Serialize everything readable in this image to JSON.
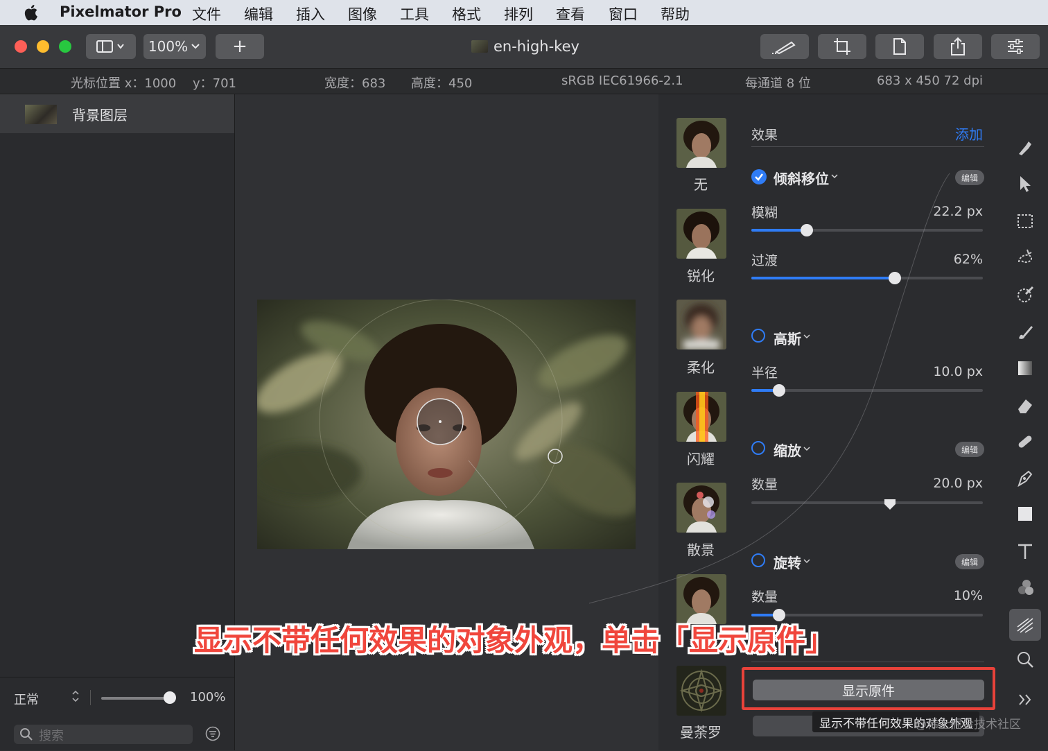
{
  "menubar": {
    "app_name": "Pixelmator Pro",
    "items": [
      "文件",
      "编辑",
      "插入",
      "图像",
      "工具",
      "格式",
      "排列",
      "查看",
      "窗口",
      "帮助"
    ]
  },
  "toolbar": {
    "zoom": "100%",
    "add_label": "+",
    "document_title": "en-high-key"
  },
  "infobar": {
    "cursor_x": "光标位置 x：1000",
    "cursor_y": "y：701",
    "width": "宽度：683",
    "height": "高度：450",
    "color_profile": "sRGB IEC61966-2.1",
    "bit_depth": "每通道 8 位",
    "dimensions": "683 x 450 72 dpi"
  },
  "layers": {
    "items": [
      {
        "name": "背景图层"
      }
    ],
    "blend_mode": "正常",
    "opacity": "100%",
    "search_placeholder": "搜索"
  },
  "effects_browser": {
    "items": [
      {
        "label": "无"
      },
      {
        "label": "锐化"
      },
      {
        "label": "柔化"
      },
      {
        "label": "闪耀"
      },
      {
        "label": "散景"
      },
      {
        "label": ""
      },
      {
        "label": "曼荼罗"
      }
    ]
  },
  "effects_panel": {
    "header": "效果",
    "add_label": "添加",
    "edit_label": "编辑",
    "effects": [
      {
        "name": "倾斜移位",
        "enabled": true,
        "params": [
          {
            "label": "模糊",
            "value": "22.2 px",
            "fraction": 0.24
          },
          {
            "label": "过渡",
            "value": "62%",
            "fraction": 0.62
          }
        ]
      },
      {
        "name": "高斯",
        "enabled": false,
        "params": [
          {
            "label": "半径",
            "value": "10.0 px",
            "fraction": 0.12
          }
        ]
      },
      {
        "name": "缩放",
        "enabled": false,
        "params": [
          {
            "label": "数量",
            "value": "20.0 px",
            "fraction": 0.6
          }
        ]
      },
      {
        "name": "旋转",
        "enabled": false,
        "params": [
          {
            "label": "数量",
            "value": "10%",
            "fraction": 0.12
          }
        ]
      }
    ],
    "show_original_label": "显示原件",
    "tooltip": "显示不带任何效果的对象外观"
  },
  "caption": "显示不带任何效果的对象外观，单击「显示原件」",
  "watermark": "@稀土掘金技术社区",
  "colors": {
    "accent": "#2f7cf6",
    "highlight": "#e8423a",
    "caption": "#f0463c"
  }
}
